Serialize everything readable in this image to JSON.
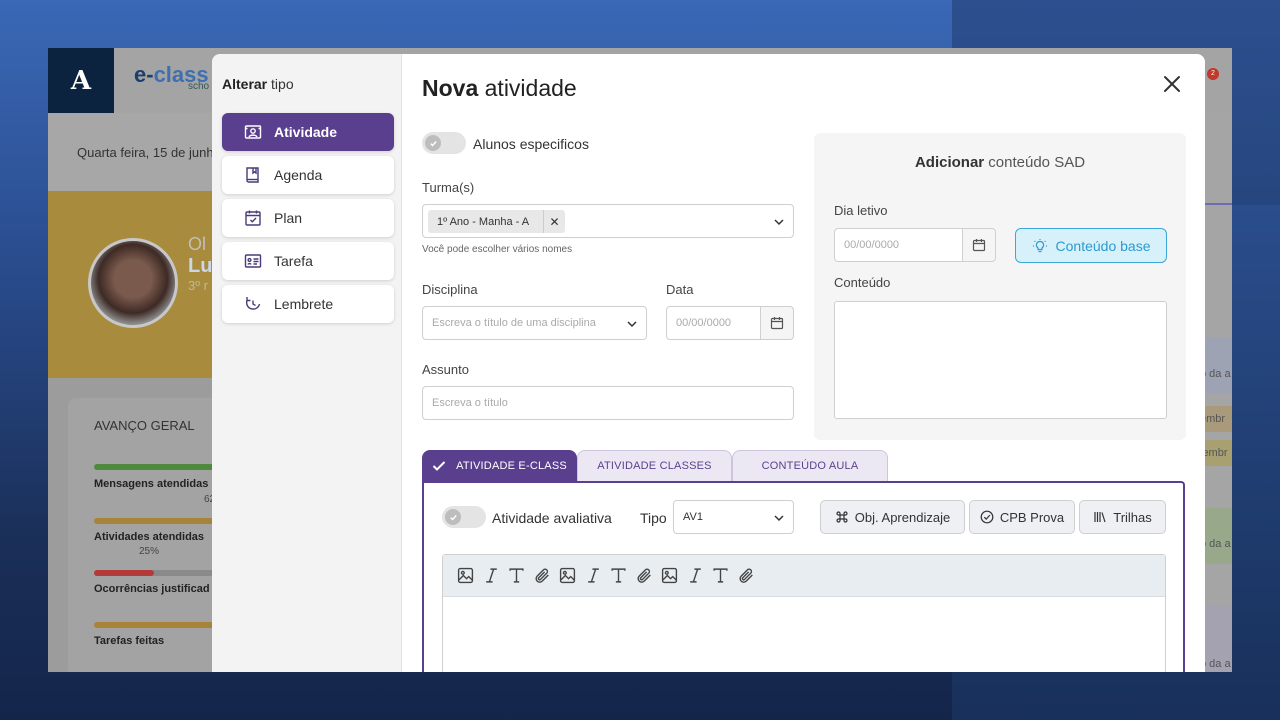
{
  "background_app": {
    "logo_letter": "A",
    "brand": {
      "part1": "e-",
      "part2": "class",
      "sub": "scho"
    },
    "date": "Quarta feira, 15 de junh",
    "profile": {
      "greeting": "Ol",
      "name": "Lu",
      "grade": "3º r"
    },
    "notification_count": "2",
    "progress": {
      "title": "AVANÇO GERAL",
      "metrics": [
        {
          "label": "Mensagens atendidas",
          "value": "62"
        },
        {
          "label": "Atividades atendidas",
          "value": "25%"
        },
        {
          "label": "Ocorrências justificad",
          "value": ""
        },
        {
          "label": "Tarefas feitas",
          "value": ""
        }
      ]
    },
    "right_items": [
      "o da a",
      "embr",
      "lembr",
      "o da a",
      "o da a"
    ]
  },
  "modal": {
    "side_title_bold": "Alterar",
    "side_title_rest": " tipo",
    "types": [
      {
        "label": "Atividade",
        "icon": "activity-icon",
        "active": true
      },
      {
        "label": "Agenda",
        "icon": "book-icon",
        "active": false
      },
      {
        "label": "Plan",
        "icon": "calendar-check-icon",
        "active": false
      },
      {
        "label": "Tarefa",
        "icon": "task-list-icon",
        "active": false
      },
      {
        "label": "Lembrete",
        "icon": "reminder-icon",
        "active": false
      }
    ],
    "title_bold": "Nova",
    "title_rest": " atividade",
    "alunos_toggle_label": "Alunos especificos",
    "turmas": {
      "label": "Turma(s)",
      "chip": "1º Ano - Manha - A",
      "help": "Você pode escolher vários nomes"
    },
    "disciplina": {
      "label": "Disciplina",
      "placeholder": "Escreva o título de uma disciplina"
    },
    "data": {
      "label": "Data",
      "placeholder": "00/00/0000"
    },
    "assunto": {
      "label": "Assunto",
      "placeholder": "Escreva o título"
    },
    "sad": {
      "title_bold": "Adicionar",
      "title_rest": " conteúdo SAD",
      "dia_letivo_label": "Dia letivo",
      "dia_letivo_placeholder": "00/00/0000",
      "conteudo_base_label": "Conteúdo base",
      "conteudo_label": "Conteúdo"
    },
    "tabs": [
      "ATIVIDADE E-CLASS",
      "ATIVIDADE CLASSES",
      "CONTEÚDO AULA"
    ],
    "avaliativa_label": "Atividade avaliativa",
    "tipo_label": "Tipo",
    "tipo_value": "AV1",
    "pills": [
      "Obj. Aprendizaje",
      "CPB Prova",
      "Trilhas"
    ],
    "toolbar_icons": [
      "image-icon",
      "italic-icon",
      "text-icon",
      "attach-icon",
      "image-icon",
      "italic-icon",
      "text-icon",
      "attach-icon",
      "image-icon",
      "italic-icon",
      "text-icon",
      "attach-icon"
    ]
  },
  "colors": {
    "primary": "#5b3f8f",
    "accent_blue": "#2b9ad0",
    "dark_navy": "#0c2340"
  }
}
